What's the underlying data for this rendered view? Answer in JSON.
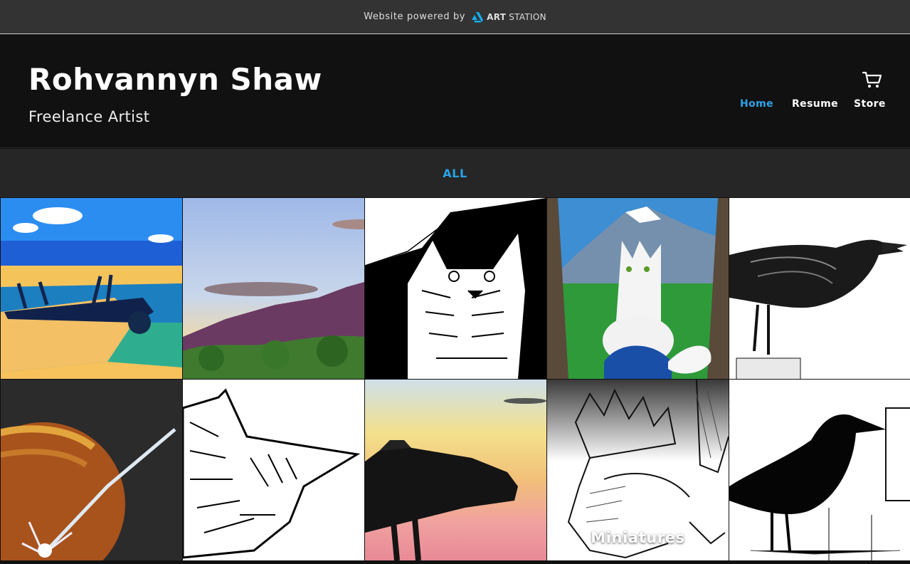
{
  "topbar": {
    "powered_text": "Website powered by",
    "brand_bold": "ART",
    "brand_light": "STATION"
  },
  "header": {
    "title": "Rohvannyn Shaw",
    "subtitle": "Freelance Artist"
  },
  "nav": {
    "home": "Home",
    "resume": "Resume",
    "store": "Store",
    "active": "Home"
  },
  "filter": {
    "label": "ALL"
  },
  "gallery": {
    "tiles": [
      {
        "subject": "yellow-biplane-painting",
        "caption": ""
      },
      {
        "subject": "mountain-sunset-painting",
        "caption": ""
      },
      {
        "subject": "bobcat-ink-drawing",
        "caption": ""
      },
      {
        "subject": "white-fox-painting",
        "caption": ""
      },
      {
        "subject": "raven-ink-drawing",
        "caption": ""
      },
      {
        "subject": "planet-impact-drawing",
        "caption": ""
      },
      {
        "subject": "sleeping-kitten-ink-drawing",
        "caption": ""
      },
      {
        "subject": "jet-silhouette-sunset-drawing",
        "caption": ""
      },
      {
        "subject": "crystal-dragon-ink-drawing",
        "caption": "Miniatures"
      },
      {
        "subject": "crow-ink-drawing",
        "caption": ""
      }
    ]
  },
  "colors": {
    "accent": "#2aa3e8",
    "header_bg": "#111111",
    "topbar_bg": "#333333",
    "filterbar_bg": "#262626"
  }
}
